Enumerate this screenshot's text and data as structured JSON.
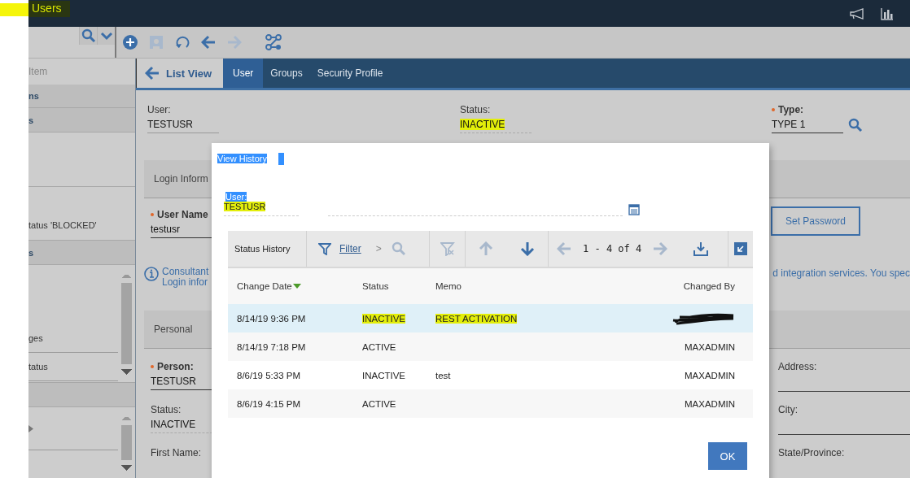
{
  "app_title": {
    "text": "Users",
    "highlighted": true
  },
  "header_icons": [
    {
      "kind": "megaphone"
    },
    {
      "kind": "chart"
    }
  ],
  "toolbar": {
    "buttons": [
      {
        "kind": "search",
        "disabled": false
      },
      {
        "kind": "chevron",
        "disabled": false
      },
      {
        "kind": "add",
        "disabled": false
      },
      {
        "kind": "save",
        "disabled": true
      },
      {
        "kind": "undo",
        "disabled": false
      },
      {
        "kind": "back",
        "disabled": false
      },
      {
        "kind": "forward",
        "disabled": true
      },
      {
        "kind": "workflow",
        "disabled": false
      }
    ]
  },
  "left_panel": {
    "rows": [
      {
        "kind": "title",
        "label": "Item"
      },
      {
        "kind": "section",
        "label": "ns"
      },
      {
        "kind": "section",
        "label": "s"
      },
      {
        "kind": "blank"
      },
      {
        "kind": "item",
        "label": "tatus 'BLOCKED'"
      },
      {
        "kind": "section",
        "label": "s"
      },
      {
        "kind": "scroll_list",
        "items": [
          {
            "label": "ges"
          },
          {
            "label": "tatus"
          }
        ]
      },
      {
        "kind": "section"
      },
      {
        "kind": "scroll_list",
        "items": [
          {
            "submenu": true
          }
        ]
      }
    ]
  },
  "tabs": {
    "back_link": "List View",
    "items": [
      {
        "label": "User",
        "selected": true
      },
      {
        "label": "Groups",
        "selected": false
      },
      {
        "label": "Security Profile",
        "selected": false
      }
    ]
  },
  "form": {
    "top_fields": [
      {
        "label": "User:",
        "value": "TESTUSR",
        "read_only": false
      },
      {
        "label": "Status:",
        "value": "INACTIVE",
        "highlighted": true,
        "read_only": true
      },
      {
        "label": "Type:",
        "value": "TYPE 1",
        "required": true,
        "read_only": false,
        "lookup": true
      }
    ],
    "login_section": {
      "title": "Login Inform",
      "user_name": {
        "label": "User Name",
        "value": "testusr",
        "required": true,
        "read_only": false
      },
      "button": "Set Password",
      "info_lines": [
        "Consultant",
        "Login infor"
      ],
      "info_right": "d integration services. You spec"
    },
    "personal_section": {
      "title": "Personal",
      "fields": [
        {
          "label": "Person:",
          "value": "TESTUSR",
          "required": true,
          "read_only": false
        },
        {
          "label": "Address:"
        },
        {
          "label": "Status:",
          "value": "INACTIVE",
          "read_only": true
        },
        {
          "label": "City:"
        },
        {
          "label": "First Name:"
        },
        {
          "label": "State/Province:"
        }
      ]
    }
  },
  "dialog": {
    "title": "View History",
    "title_selected": true,
    "user_field": {
      "label": "User:",
      "label_selected": true,
      "value": "TESTUSR",
      "highlighted": true
    },
    "table": {
      "title": "Status History",
      "filter_link": "Filter",
      "breadcrumb": ">",
      "paging": "1 - 4 of 4",
      "tools": [
        {
          "kind": "search",
          "disabled": true
        },
        {
          "kind": "clear_filter",
          "disabled": true
        },
        {
          "kind": "up",
          "disabled": true
        },
        {
          "kind": "down",
          "disabled": false
        },
        {
          "kind": "prev",
          "disabled": true
        },
        {
          "kind": "next",
          "disabled": true
        },
        {
          "kind": "download",
          "disabled": false
        },
        {
          "kind": "restore",
          "disabled": false
        }
      ],
      "columns": [
        {
          "label": "Change Date",
          "sort_descending": true
        },
        {
          "label": "Status"
        },
        {
          "label": "Memo"
        },
        {
          "label": "Changed By"
        }
      ],
      "rows": [
        {
          "change_date": "8/14/19 9:36 PM",
          "status": "INACTIVE",
          "status_highlighted": true,
          "memo": "REST ACTIVATION",
          "memo_highlighted": true,
          "changed_by_redacted": true,
          "selected": true
        },
        {
          "change_date": "8/14/19 7:18 PM",
          "status": "ACTIVE",
          "changed_by": "MAXADMIN",
          "selected": false
        },
        {
          "change_date": "8/6/19 5:33 PM",
          "status": "INACTIVE",
          "memo": "test",
          "changed_by": "MAXADMIN",
          "selected": false
        },
        {
          "change_date": "8/6/19 4:15 PM",
          "status": "ACTIVE",
          "changed_by": "MAXADMIN",
          "selected": false
        }
      ]
    },
    "ok_button": "OK"
  }
}
